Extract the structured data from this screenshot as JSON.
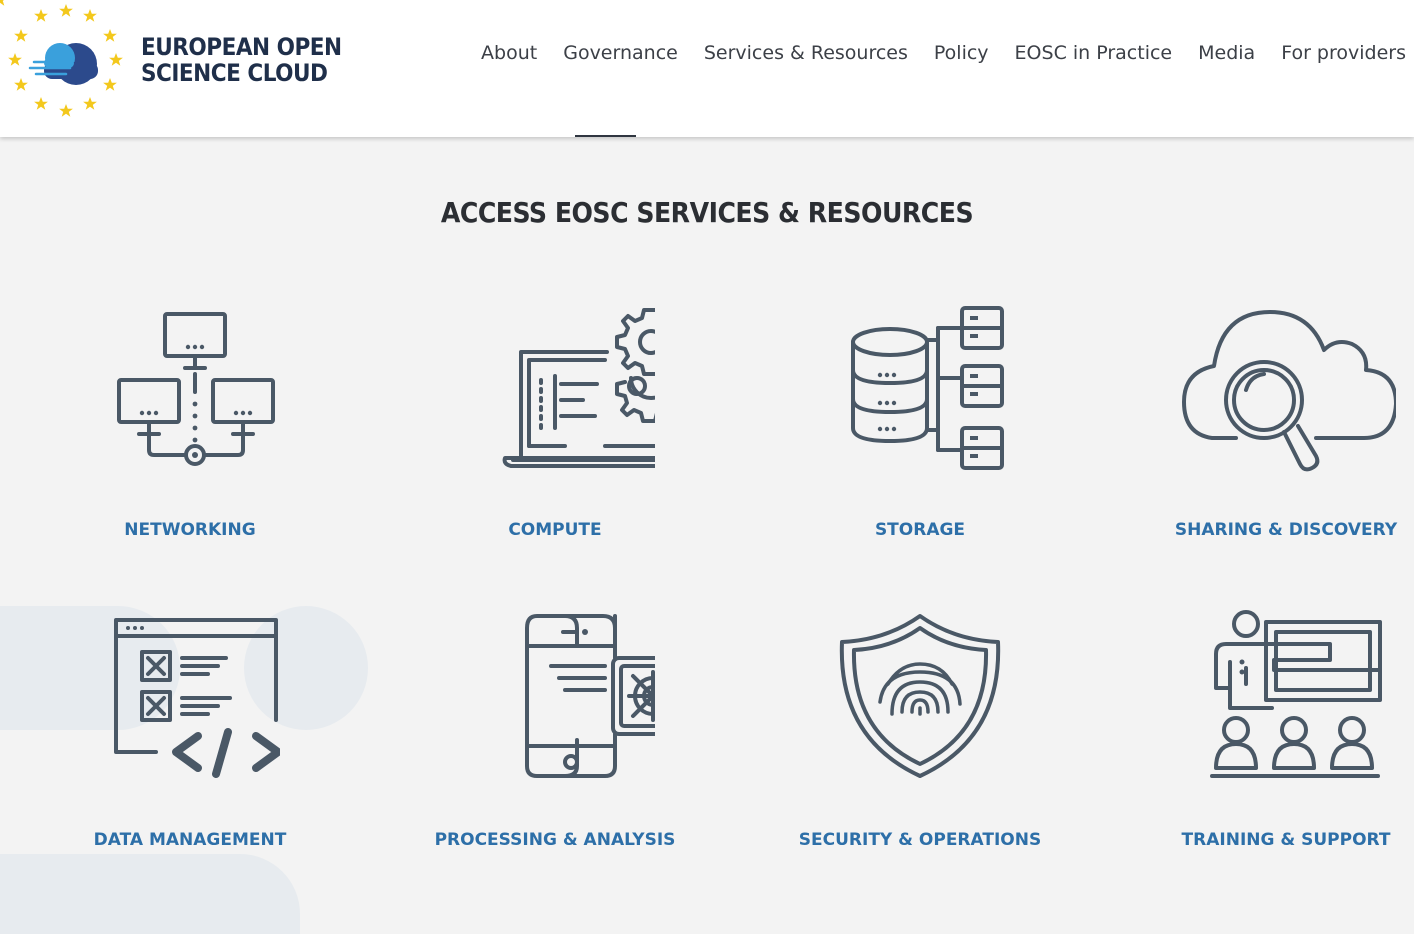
{
  "brand": {
    "line1": "EUROPEAN OPEN",
    "line2": "SCIENCE CLOUD",
    "colors": {
      "star": "#f3c81c",
      "cloud_blue": "#3aa0dc",
      "cloud_navy": "#2c4a8c",
      "text": "#1f2f4a"
    }
  },
  "nav": {
    "items": [
      "About",
      "Governance",
      "Services & Resources",
      "Policy",
      "EOSC in Practice",
      "Media",
      "For providers"
    ]
  },
  "section": {
    "title": "ACCESS EOSC SERVICES & RESOURCES"
  },
  "cards": [
    {
      "label": "NETWORKING",
      "icon": "network-icon"
    },
    {
      "label": "COMPUTE",
      "icon": "laptop-gear-icon"
    },
    {
      "label": "STORAGE",
      "icon": "database-icon"
    },
    {
      "label": "SHARING & DISCOVERY",
      "icon": "cloud-search-icon"
    },
    {
      "label": "DATA MANAGEMENT",
      "icon": "code-window-icon"
    },
    {
      "label": "PROCESSING & ANALYSIS",
      "icon": "mobile-processing-icon"
    },
    {
      "label": "SECURITY & OPERATIONS",
      "icon": "fingerprint-shield-icon"
    },
    {
      "label": "TRAINING & SUPPORT",
      "icon": "presentation-icon"
    }
  ],
  "colors": {
    "label": "#2d6fa8",
    "icon": "#4a5866",
    "background": "#f3f3f3"
  }
}
